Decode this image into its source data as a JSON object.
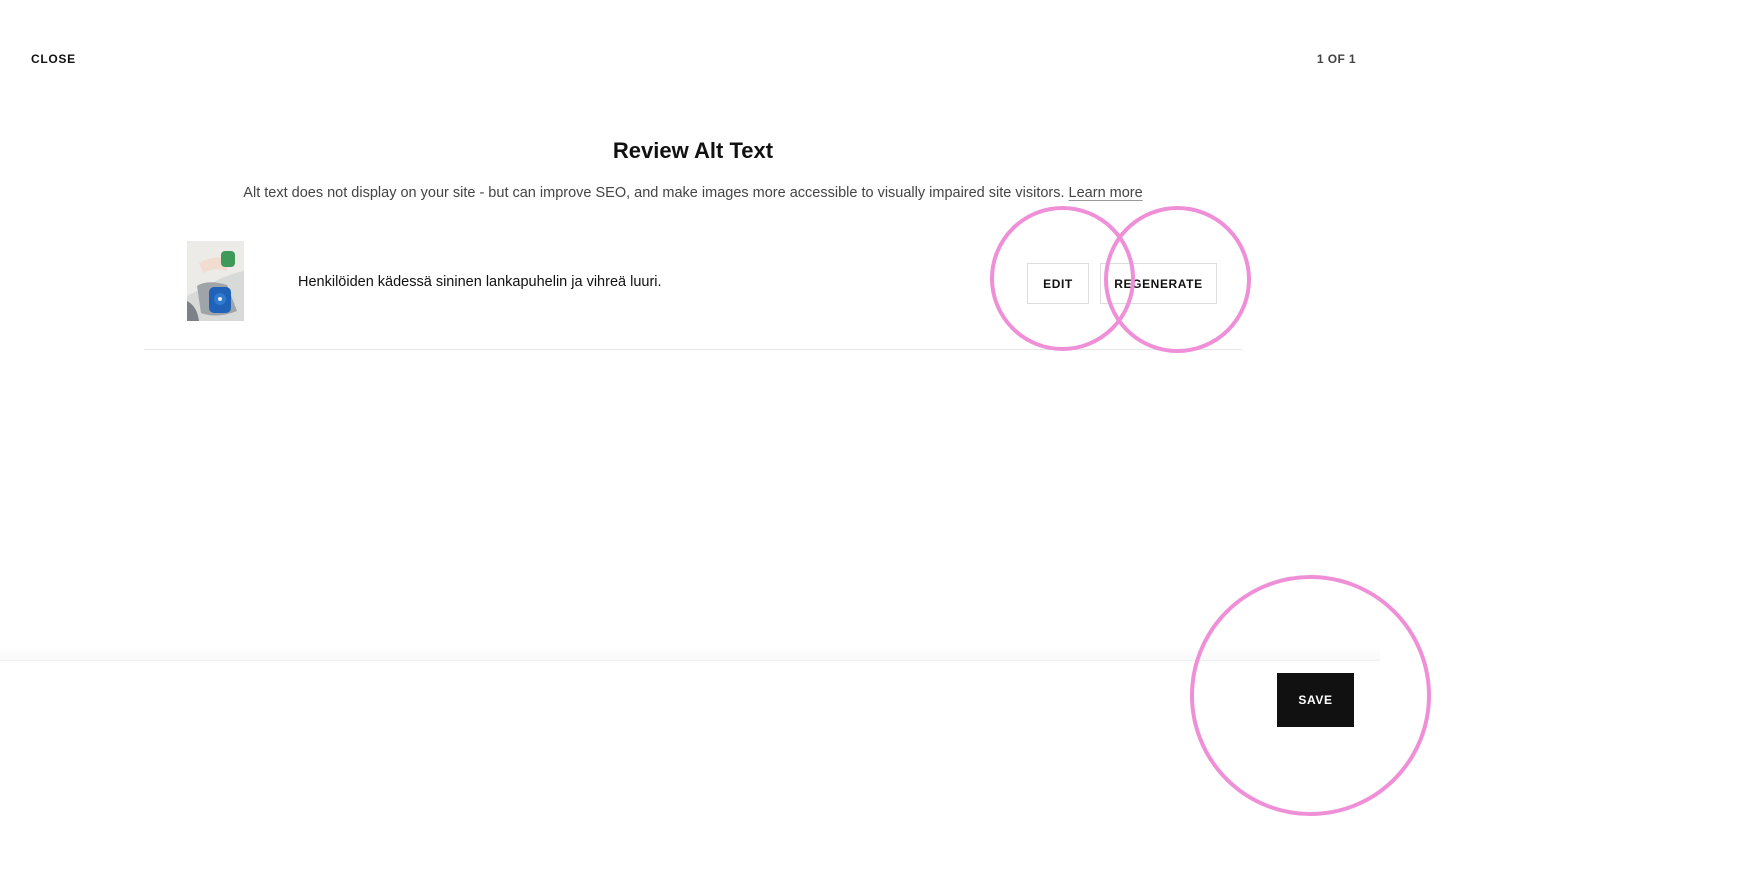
{
  "header": {
    "close_label": "CLOSE",
    "pager": "1 OF 1"
  },
  "main": {
    "title": "Review Alt Text",
    "description": "Alt text does not display on your site - but can improve SEO, and make images more accessible to visually impaired site visitors.",
    "learn_more_label": "Learn more",
    "items": [
      {
        "alt_text": "Henkilöiden kädessä sininen lankapuhelin ja vihreä luuri.",
        "edit_label": "EDIT",
        "regenerate_label": "REGENERATE"
      }
    ]
  },
  "footer": {
    "save_label": "SAVE"
  },
  "colors": {
    "highlight": "#ef8fd8",
    "save_button": "#111111"
  }
}
